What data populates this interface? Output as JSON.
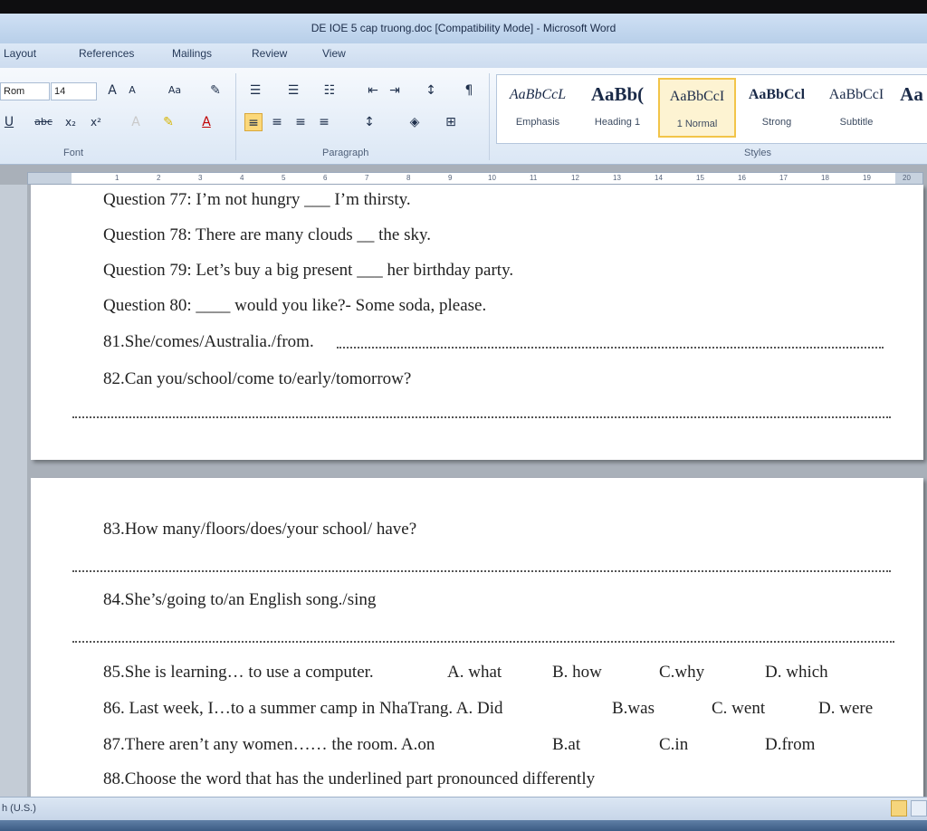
{
  "window": {
    "title": "DE IOE 5 cap truong.doc [Compatibility Mode] - Microsoft Word"
  },
  "tabs": [
    "Layout",
    "References",
    "Mailings",
    "Review",
    "View"
  ],
  "ribbon": {
    "font_name": "Rom",
    "font_size": "14",
    "font_group_label": "Font",
    "paragraph_group_label": "Paragraph",
    "styles_group_label": "Styles",
    "styles": [
      {
        "preview": "AaBbCcL",
        "name": "Emphasis"
      },
      {
        "preview": "AaBb(",
        "name": "Heading 1"
      },
      {
        "preview": "AaBbCcI",
        "name": "1 Normal"
      },
      {
        "preview": "AaBbCcl",
        "name": "Strong"
      },
      {
        "preview": "AaBbCcI",
        "name": "Subtitle"
      },
      {
        "preview": "Aa",
        "name": ""
      }
    ]
  },
  "ruler": {
    "numbers": [
      "1",
      "2",
      "3",
      "4",
      "5",
      "6",
      "7",
      "8",
      "9",
      "10",
      "11",
      "12",
      "13",
      "14",
      "15",
      "16",
      "17",
      "18",
      "19",
      "20"
    ]
  },
  "document": {
    "page1_lines": [
      "Question 77: I’m not hungry ___ I’m thirsty.",
      "Question 78: There are many clouds __ the sky.",
      "Question 79: Let’s buy a big present ___ her birthday party.",
      "Question 80: ____ would you like?- Some soda, please.",
      "81.She/comes/Australia./from.",
      "82.Can you/school/come to/early/tomorrow?"
    ],
    "page2_lines": [
      "83.How many/floors/does/your school/ have?",
      "84.She’s/going to/an English song./sing"
    ],
    "q85": {
      "text": "85.She is learning… to use a computer.",
      "a": "A. what",
      "b": "B. how",
      "c": "C.why",
      "d": "D. which"
    },
    "q86": {
      "text": "86. Last week, I…to a summer camp in NhaTrang. A. Did",
      "b": "B.was",
      "c": "C. went",
      "d": "D. were"
    },
    "q87": {
      "text": "87.There aren’t any women…… the room.  A.on",
      "b": "B.at",
      "c": "C.in",
      "d": "D.from"
    },
    "q88": "88.Choose the word that has the underlined part pronounced differently"
  },
  "status": {
    "language": "h (U.S.)"
  },
  "colors": {
    "ribbon_accent": "#fbd87a",
    "selected_style_border": "#f2c449"
  }
}
